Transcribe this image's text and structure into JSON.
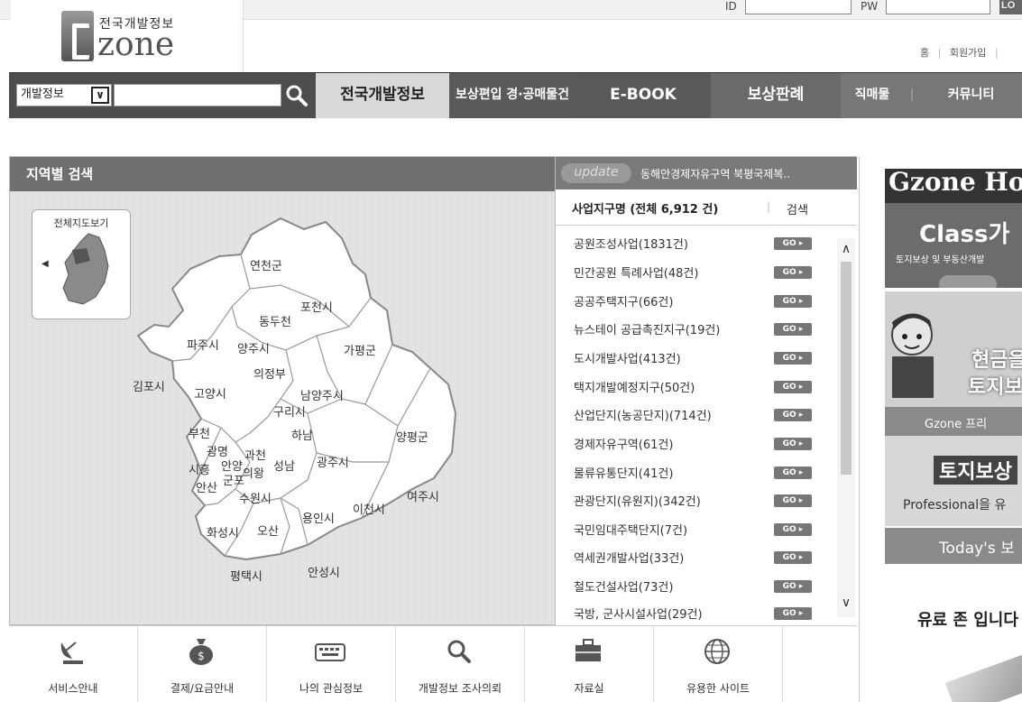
{
  "login": {
    "id_label": "ID",
    "pw_label": "PW",
    "button": "LO"
  },
  "logo": {
    "korean": "전국개발정보",
    "wordmark": "zone"
  },
  "util_links": [
    "홈",
    "회원가입"
  ],
  "search": {
    "select_value": "개발정보"
  },
  "nav": [
    "전국개발정보",
    "보상편입 경·공매물건",
    "E-BOOK",
    "보상판례",
    "직매물",
    "커뮤니티"
  ],
  "region": {
    "title": "지역별 검색",
    "minimap_label": "전체지도보기",
    "cities": [
      "연천군",
      "포천시",
      "동두천",
      "파주시",
      "양주시",
      "가평군",
      "의정부",
      "김포시",
      "고양시",
      "남양주시",
      "구리시",
      "부천",
      "하남",
      "양평군",
      "광명",
      "과천",
      "광주시",
      "시흥",
      "안양",
      "의왕",
      "성남",
      "군포",
      "안산",
      "수원시",
      "이천시",
      "여주시",
      "용인시",
      "화성시",
      "오산",
      "평택시",
      "안성시"
    ]
  },
  "list": {
    "update_badge": "update",
    "update_text": "동해안경제자유구역 북평국제복..",
    "header_title": "사업지구명 (전체 6,912 건)",
    "header_search": "검색",
    "go_label": "GO ▸",
    "items": [
      "공원조성사업(1831건)",
      "민간공원 특례사업(48건)",
      "공공주택지구(66건)",
      "뉴스테이 공급촉진지구(19건)",
      "도시개발사업(413건)",
      "택지개발예정지구(50건)",
      "산업단지(농공단지)(714건)",
      "경제자유구역(61건)",
      "물류유통단지(41건)",
      "관광단지(유원지)(342건)",
      "국민임대주택단지(7건)",
      "역세권개발사업(33건)",
      "철도건설사업(73건)",
      "국방, 군사시설사업(29건)"
    ]
  },
  "banners": {
    "b1_text": "Gzone Ho",
    "b2_title": "Class가",
    "b2_sub": "토지보상 및 부동산개발",
    "b3_big": "현금을",
    "b3_big2": "토지보",
    "b3_caption": "Gzone 프리",
    "b4_title": "토지보상",
    "b4_sub": "Professional을 유",
    "b5_title": "Today's 보",
    "b6_text": "유료 존 입니다"
  },
  "bottom": [
    "서비스안내",
    "결제/요금안내",
    "나의 관심정보",
    "개발정보 조사의뢰",
    "자료실",
    "유용한 사이트"
  ]
}
